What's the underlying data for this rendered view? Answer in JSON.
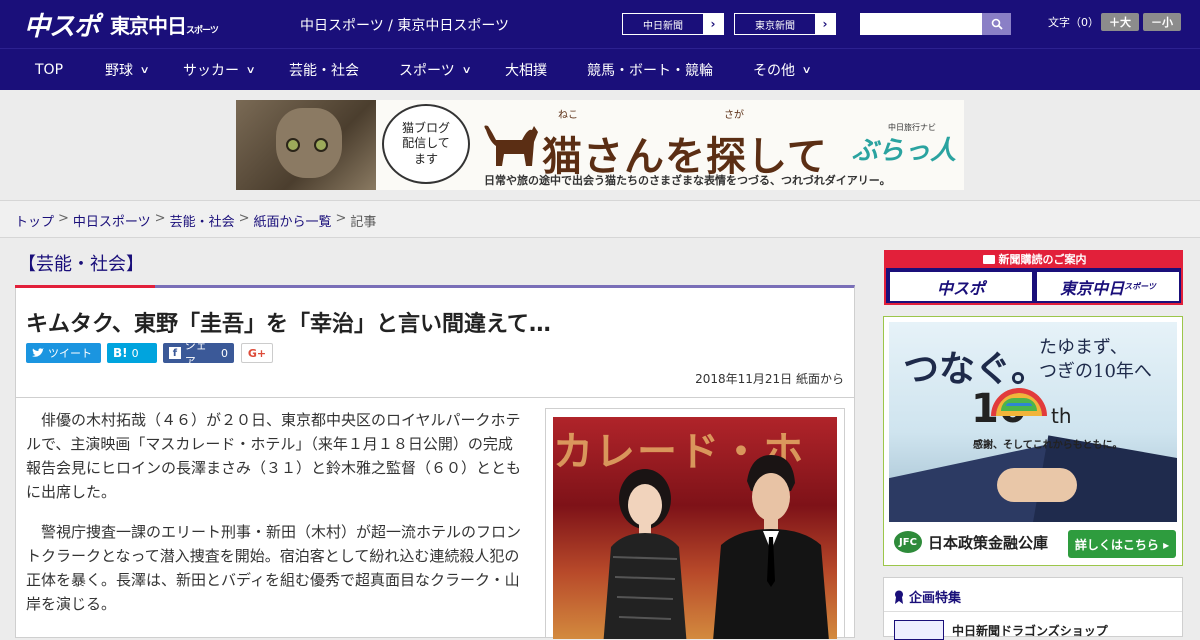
{
  "header": {
    "logo_chunichi_sports": "中スポ",
    "logo_tokyo_chunichi": "東京中日",
    "logo_tokyo_chunichi_suffix": "スポーツ",
    "site_name": "中日スポーツ / 東京中日スポーツ",
    "paper_links": [
      {
        "label": "中日新聞"
      },
      {
        "label": "東京新聞"
      }
    ],
    "search": {
      "placeholder": "",
      "value": ""
    },
    "font_size": {
      "label": "文字（0）",
      "larger": "＋大",
      "smaller": "－小"
    }
  },
  "nav": {
    "items": [
      {
        "label": "TOP",
        "has_menu": false
      },
      {
        "label": "野球",
        "has_menu": true
      },
      {
        "label": "サッカー",
        "has_menu": true
      },
      {
        "label": "芸能・社会",
        "has_menu": false
      },
      {
        "label": "スポーツ",
        "has_menu": true
      },
      {
        "label": "大相撲",
        "has_menu": false
      },
      {
        "label": "競馬・ボート・競輪",
        "has_menu": false
      },
      {
        "label": "その他",
        "has_menu": true
      }
    ]
  },
  "banner": {
    "bubble_text": "猫ブログ\n配信して\nます",
    "title": "猫さんを探して",
    "ruby_neko": "ねこ",
    "ruby_saga": "さが",
    "subtitle": "日常や旅の途中で出会う猫たちのさまざまな表情をつづる、つれづれダイアリー。",
    "brand_small": "中日旅行ナビ",
    "brand": "ぶらっ人"
  },
  "breadcrumb": [
    {
      "label": "トップ",
      "link": true
    },
    {
      "label": "中日スポーツ",
      "link": true
    },
    {
      "label": "芸能・社会",
      "link": true
    },
    {
      "label": "紙面から一覧",
      "link": true
    },
    {
      "label": "記事",
      "link": false
    }
  ],
  "article": {
    "category": "【芸能・社会】",
    "title": "キムタク、東野「圭吾」を「幸治」と言い間違えて…",
    "share": {
      "tweet": "ツイート",
      "hatena_label": "B!",
      "hatena_count": "0",
      "facebook": "シェア",
      "facebook_count": "0",
      "gplus": "G+"
    },
    "date": "2018年11月21日 紙面から",
    "paragraphs": [
      "俳優の木村拓哉（４６）が２０日、東京都中央区のロイヤルパークホテルで、主演映画「マスカレード・ホテル」（来年１月１８日公開）の完成報告会見にヒロインの長澤まさみ（３１）と鈴木雅之監督（６０）とともに出席した。",
      "警視庁捜査一課のエリート刑事・新田（木村）が超一流ホテルのフロントクラークとなって潜入捜査を開始。宿泊客として紛れ込む連続殺人犯の正体を暴く。長澤は、新田とバディを組む優秀で超真面目なクラーク・山岸を演じる。"
    ],
    "photo_text": "カレード・ホ"
  },
  "sidebar": {
    "subscription": {
      "title": "新聞購読のご案内",
      "btn1": "中スポ",
      "btn2": "東京中日",
      "btn2_suffix": "スポーツ"
    },
    "ad": {
      "copy1": "つなぐ。",
      "copy2_line1": "たゆまず、",
      "copy2_line2": "つぎの10年へ",
      "ten": "10",
      "th": "th",
      "tagline": "感謝、そしてこれからもともに。",
      "logo": "JFC",
      "company": "日本政策金融公庫",
      "more": "詳しくはこちら ▸"
    },
    "feature": {
      "title": "企画特集",
      "item": "中日新聞ドラゴンズショップ"
    }
  },
  "colors": {
    "header_bg": "#1a0f7a",
    "accent_red": "#e2203a",
    "twitter": "#1b95e0",
    "hatena": "#00a4de",
    "facebook": "#3b5998"
  }
}
